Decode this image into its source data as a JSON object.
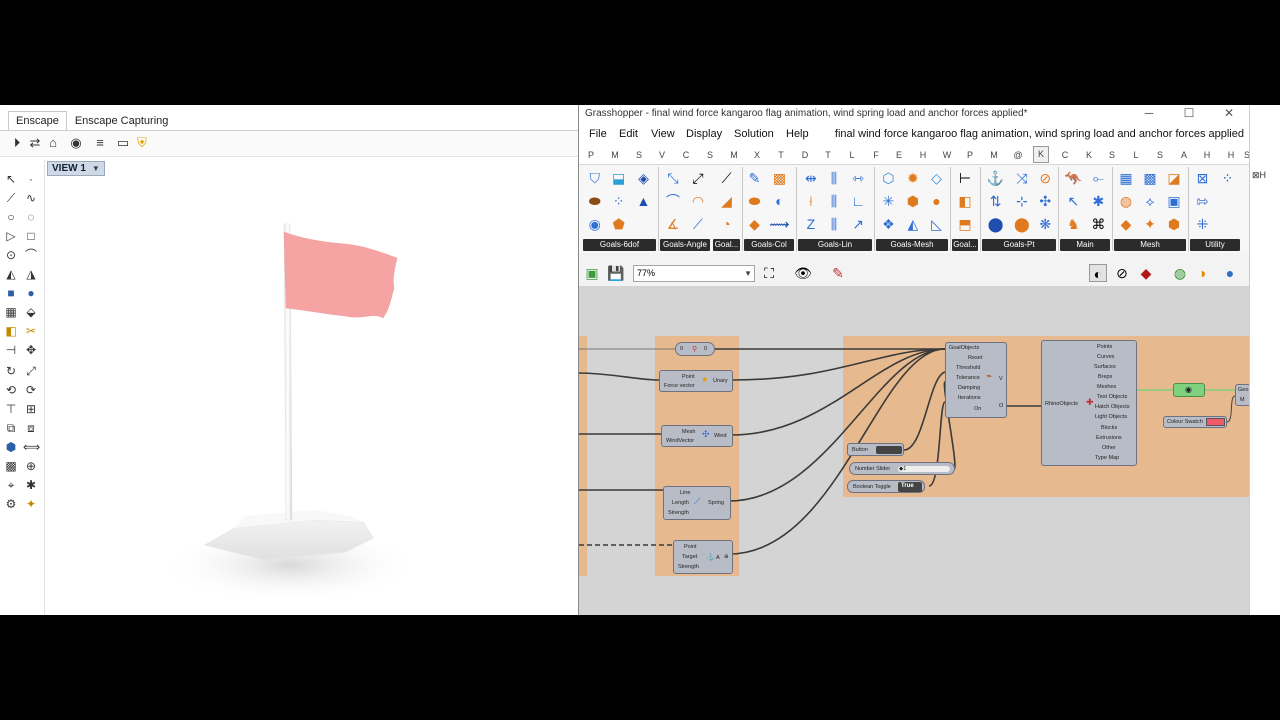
{
  "rhino": {
    "tabs": [
      "Enscape",
      "Enscape Capturing"
    ],
    "viewport_label": "VIEW 1",
    "toolbar_icons": [
      "enscape-start-icon",
      "enscape-sync-icon",
      "enscape-view-icon",
      "enscape-capture-icon",
      "enscape-settings-icon",
      "enscape-feedback-icon",
      "enscape-shield-icon"
    ]
  },
  "grasshopper": {
    "title": "Grasshopper - final wind force kangaroo flag animation, wind spring load and anchor forces applied*",
    "menu": [
      "File",
      "Edit",
      "View",
      "Display",
      "Solution",
      "Help"
    ],
    "document_name": "final wind force kangaroo flag animation, wind spring load and anchor forces applied",
    "tab_letters": [
      "P",
      "M",
      "S",
      "V",
      "C",
      "S",
      "M",
      "X",
      "T",
      "D",
      "T",
      "L",
      "F",
      "E",
      "H",
      "W",
      "P",
      "M",
      "@",
      "K",
      "C",
      "K",
      "S",
      "L",
      "S",
      "A",
      "H",
      "H",
      "S"
    ],
    "active_tab_letter": "K",
    "ribbon_groups": [
      "Goals-6dof",
      "Goals-Angle",
      "Goal...",
      "Goals-Col",
      "Goals-Lin",
      "Goals-Mesh",
      "Goal...",
      "Goals-Pt",
      "Main",
      "Mesh",
      "Utility"
    ],
    "zoom": "77%",
    "canvas": {
      "points_panel": {
        "label": "0",
        "label2": "0"
      },
      "point_component": {
        "in1": "Point",
        "in2": "Force vector",
        "out": "Unary"
      },
      "wind_component": {
        "in1": "Mesh",
        "in2": "WindVector",
        "out": "Wind"
      },
      "spring_component": {
        "in1": "Line",
        "in2": "Length",
        "in3": "Strength",
        "out": "Spring"
      },
      "anchor_component": {
        "in1": "Point",
        "in2": "Target",
        "in3": "Strength",
        "out": "A"
      },
      "solver": {
        "inputs": [
          "GoalObjects",
          "Reset",
          "Threshold",
          "Tolerance",
          "Damping",
          "Iterations",
          "On"
        ],
        "out1": "V",
        "out2": "O"
      },
      "deconstruct": {
        "input": "RhinoObjects",
        "outputs": [
          "Points",
          "Curves",
          "Surfaces",
          "Breps",
          "Meshes",
          "Text Objects",
          "Hatch Objects",
          "Light Objects",
          "Blocks",
          "Extrusions",
          "Other",
          "Type Map"
        ]
      },
      "button": {
        "label": "Button"
      },
      "slider": {
        "label": "Number Slider",
        "value": "◆1"
      },
      "toggle": {
        "label": "Boolean Toggle",
        "value": "True"
      },
      "swatch": {
        "label": "Colour Swatch"
      },
      "far_right": {
        "label1": "Geo",
        "label2": "M"
      }
    }
  },
  "colors": {
    "group_fill": "#e6b98f",
    "flag": "#f5a3a3",
    "swatch": "#f25a6b"
  }
}
